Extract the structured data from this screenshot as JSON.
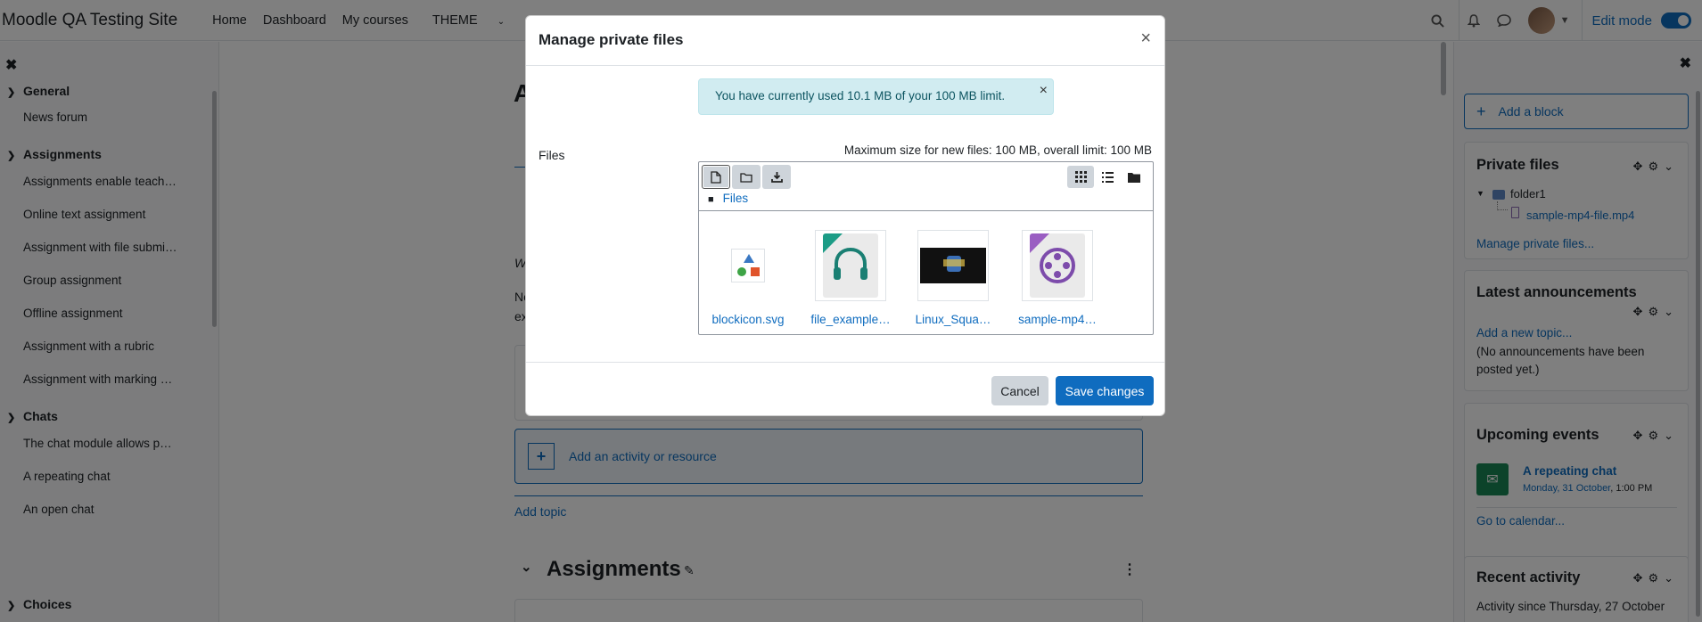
{
  "navbar": {
    "site_name": "Moodle QA Testing Site",
    "links": [
      "Home",
      "Dashboard",
      "My courses",
      "THEME"
    ],
    "edit_mode_label": "Edit mode"
  },
  "left_drawer": {
    "sections": [
      {
        "title": "General",
        "items": [
          "News forum"
        ]
      },
      {
        "title": "Assignments",
        "items": [
          "Assignments enable teach…",
          "Online text assignment",
          "Assignment with file submi…",
          "Group assignment",
          "Offline assignment",
          "Assignment with a rubric",
          "Assignment with marking …"
        ]
      },
      {
        "title": "Chats",
        "items": [
          "The chat module allows p…",
          "A repeating chat",
          "An open chat"
        ]
      },
      {
        "title": "Choices",
        "items": []
      }
    ]
  },
  "main": {
    "add_activity": "Add an activity or resource",
    "add_topic": "Add topic",
    "section_title": "Assignments",
    "partial_heading": "A",
    "partial_text": [
      "W",
      "Ne",
      "ex"
    ]
  },
  "right_drawer": {
    "add_block": "Add a block",
    "private_files": {
      "title": "Private files",
      "folder": "folder1",
      "file": "sample-mp4-file.mp4",
      "manage_link": "Manage private files..."
    },
    "announcements": {
      "title": "Latest announcements",
      "add_link": "Add a new topic...",
      "empty_text": "(No announcements have been posted yet.)"
    },
    "upcoming": {
      "title": "Upcoming events",
      "event_name": "A repeating chat",
      "event_date": "Monday, 31 October",
      "event_time": ", 1:00 PM",
      "calendar_link": "Go to calendar..."
    },
    "recent": {
      "title": "Recent activity",
      "since_text": "Activity since Thursday, 27 October"
    }
  },
  "modal": {
    "title": "Manage private files",
    "alert": "You have currently used 10.1 MB of your 100 MB limit.",
    "files_label": "Files",
    "max_size": "Maximum size for new files: 100 MB, overall limit: 100 MB",
    "breadcrumb": "Files",
    "files": [
      {
        "name": "blockicon.svg",
        "icon": "image-shapes-icon"
      },
      {
        "name": "file_example…",
        "icon": "audio-file-icon"
      },
      {
        "name": "Linux_Squa…",
        "icon": "image-thumbnail-icon"
      },
      {
        "name": "sample-mp4…",
        "icon": "video-file-icon"
      }
    ],
    "cancel_label": "Cancel",
    "save_label": "Save changes"
  }
}
